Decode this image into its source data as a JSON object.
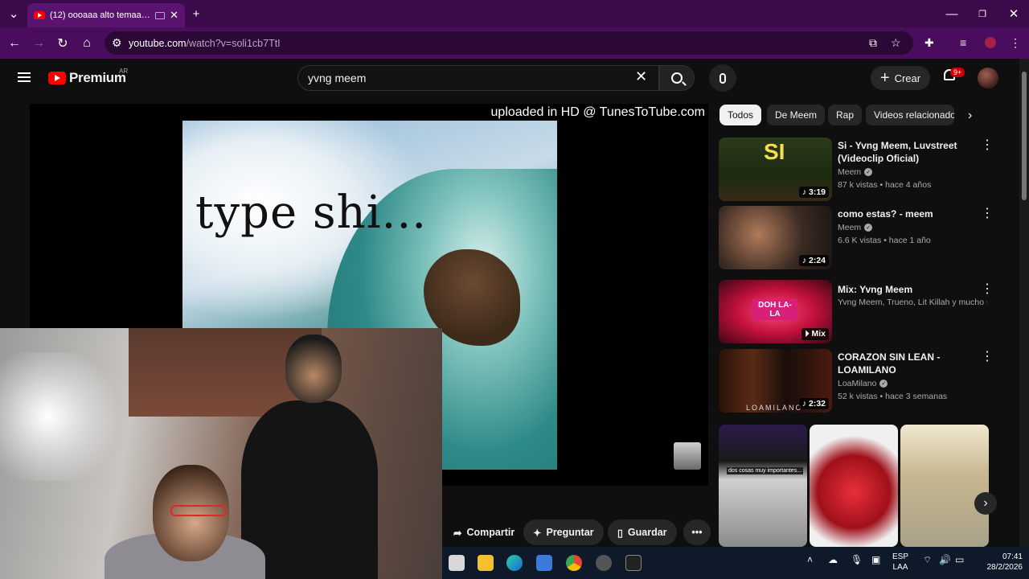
{
  "browser": {
    "tab_title": "(12) oooaaa alto temaa.mp",
    "new_tab": "+",
    "url_host": "youtube.com",
    "url_path": "/watch?v=soli1cb7TtI",
    "window_min": "—",
    "window_max": "❐",
    "window_close": "✕"
  },
  "youtube": {
    "logo_text": "Premium",
    "region": "AR",
    "search_value": "yvng  meem",
    "create_label": "Crear",
    "notif_count": "9+"
  },
  "player": {
    "watermark": "uploaded in HD @ TunesToTube.com",
    "overlay_text": "type shi..."
  },
  "actions": [
    {
      "label": "Compartir",
      "icon": "share-icon"
    },
    {
      "label": "Preguntar",
      "icon": "sparkle-icon"
    },
    {
      "label": "Guardar",
      "icon": "bookmark-icon"
    }
  ],
  "chips": [
    "Todos",
    "De Meem",
    "Rap",
    "Videos relacionado"
  ],
  "recommendations": [
    {
      "title": "Si - Yvng Meem, Luvstreet (Videoclip Oficial)",
      "channel": "Meem",
      "verified": true,
      "meta": "87 k vistas • hace 4 años",
      "duration": "♪ 3:19",
      "thumb_text": "SI"
    },
    {
      "title": "como estas? - meem",
      "channel": "Meem",
      "verified": true,
      "meta": "6.6 K vistas • hace 1 año",
      "duration": "♪ 2:24",
      "thumb_text": ""
    },
    {
      "title": "Mix: Yvng Meem",
      "channel": "Yvng Meem, Trueno, Lit Killah y mucho s...",
      "verified": false,
      "meta": "",
      "duration": "⏵ Mix",
      "thumb_text": "DOH LA-LA"
    },
    {
      "title": "CORAZON SIN LEAN - LOAMILANO",
      "channel": "LoaMilano",
      "verified": true,
      "meta": "52 k vistas • hace 3 semanas",
      "duration": "♪ 2:32",
      "thumb_text": "LOAMILANO"
    }
  ],
  "shorts_caption": "dos cosas muy importantes...",
  "taskbar": {
    "lang": "ESP",
    "lang_sub": "LAA",
    "time": "07:41",
    "date": "28/2/2026"
  }
}
